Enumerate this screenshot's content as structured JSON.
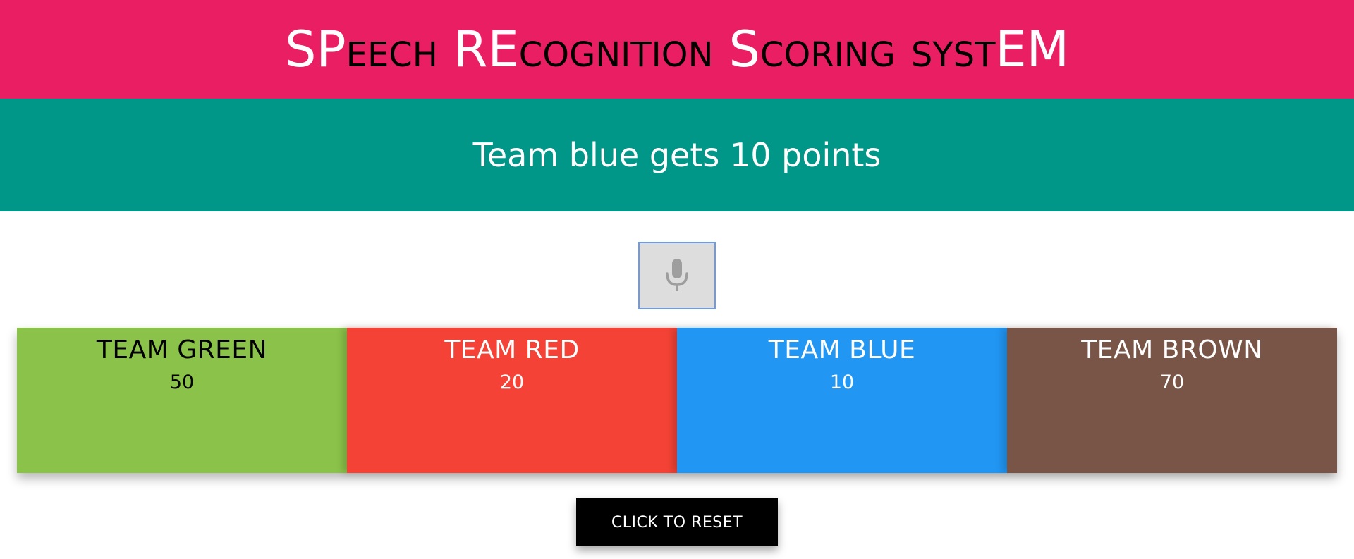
{
  "header": {
    "title_parts": [
      {
        "cap": "SP",
        "small": "EECH"
      },
      {
        "cap": "RE",
        "small": "COGNITION"
      },
      {
        "cap": "S",
        "small": "CORING"
      },
      {
        "cap": "",
        "small": "SYST",
        "cap_end": "EM"
      }
    ],
    "background": "#e91e63"
  },
  "status": {
    "text": "Team blue gets 10 points",
    "background": "#009688"
  },
  "mic": {
    "icon": "microphone-icon"
  },
  "teams": [
    {
      "name": "TEAM GREEN",
      "score": "50",
      "color": "#8bc34a"
    },
    {
      "name": "TEAM RED",
      "score": "20",
      "color": "#f44336"
    },
    {
      "name": "TEAM BLUE",
      "score": "10",
      "color": "#2196f3"
    },
    {
      "name": "TEAM BROWN",
      "score": "70",
      "color": "#795548"
    }
  ],
  "reset": {
    "label": "CLICK TO RESET"
  }
}
